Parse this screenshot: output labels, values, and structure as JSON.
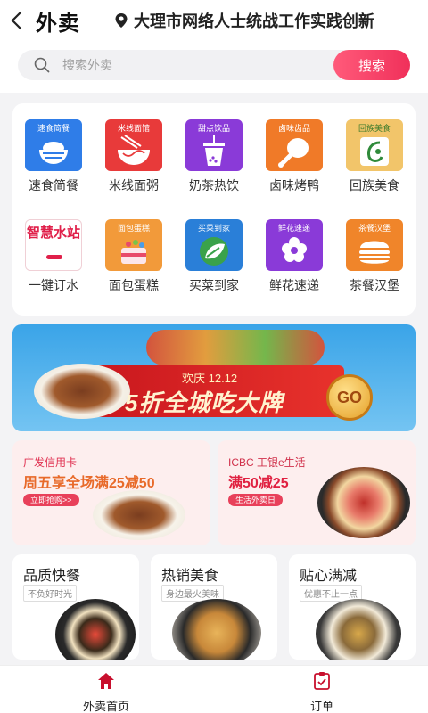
{
  "header": {
    "title": "外卖",
    "location": "大理市网络人士统战工作实践创新"
  },
  "search": {
    "placeholder": "搜索外卖",
    "button": "搜索"
  },
  "categories": [
    {
      "tag": "速食简餐",
      "label": "速食简餐",
      "icon": "rice-bowl-icon",
      "color": "#2f7de8"
    },
    {
      "tag": "米线面馆",
      "label": "米线面粥",
      "icon": "noodle-bowl-icon",
      "color": "#e83a3a"
    },
    {
      "tag": "甜点饮品",
      "label": "奶茶热饮",
      "icon": "milk-tea-icon",
      "color": "#8a3ad8"
    },
    {
      "tag": "卤味齿品",
      "label": "卤味烤鸭",
      "icon": "drumstick-icon",
      "color": "#f07a28"
    },
    {
      "tag": "回族美食",
      "label": "回族美食",
      "icon": "halal-icon",
      "color": "#f2c56a"
    },
    {
      "tag": "智慧水站",
      "label": "一键订水",
      "icon": "water-station-icon",
      "color": "#ffffff"
    },
    {
      "tag": "面包蛋糕",
      "label": "面包蛋糕",
      "icon": "cake-icon",
      "color": "#f29a3a"
    },
    {
      "tag": "买菜到家",
      "label": "买菜到家",
      "icon": "vegetable-icon",
      "color": "#2a7fd8"
    },
    {
      "tag": "鲜花速递",
      "label": "鲜花速递",
      "icon": "flower-icon",
      "color": "#8a3ad8"
    },
    {
      "tag": "茶餐汉堡",
      "label": "茶餐汉堡",
      "icon": "burger-icon",
      "color": "#f0852a"
    }
  ],
  "banner": {
    "sub": "欢庆 12.12",
    "main": "5折全城吃大牌",
    "go": "GO"
  },
  "promos": [
    {
      "title": "广发信用卡",
      "main": "周五享全场满25减50",
      "button": "立即抢购>>"
    },
    {
      "title": "ICBC 工银e生活",
      "main": "满50减25",
      "button": "生活外卖日"
    }
  ],
  "bottom_cards": [
    {
      "title": "品质快餐",
      "sub": "不负好时光"
    },
    {
      "title": "热销美食",
      "sub": "身边最火美味"
    },
    {
      "title": "贴心满减",
      "sub": "优惠不止一点"
    }
  ],
  "tabs": [
    {
      "label": "外卖首页",
      "active": true
    },
    {
      "label": "订单",
      "active": false
    }
  ],
  "colors": {
    "accent": "#f0305a",
    "active_tab": "#c8102e"
  }
}
